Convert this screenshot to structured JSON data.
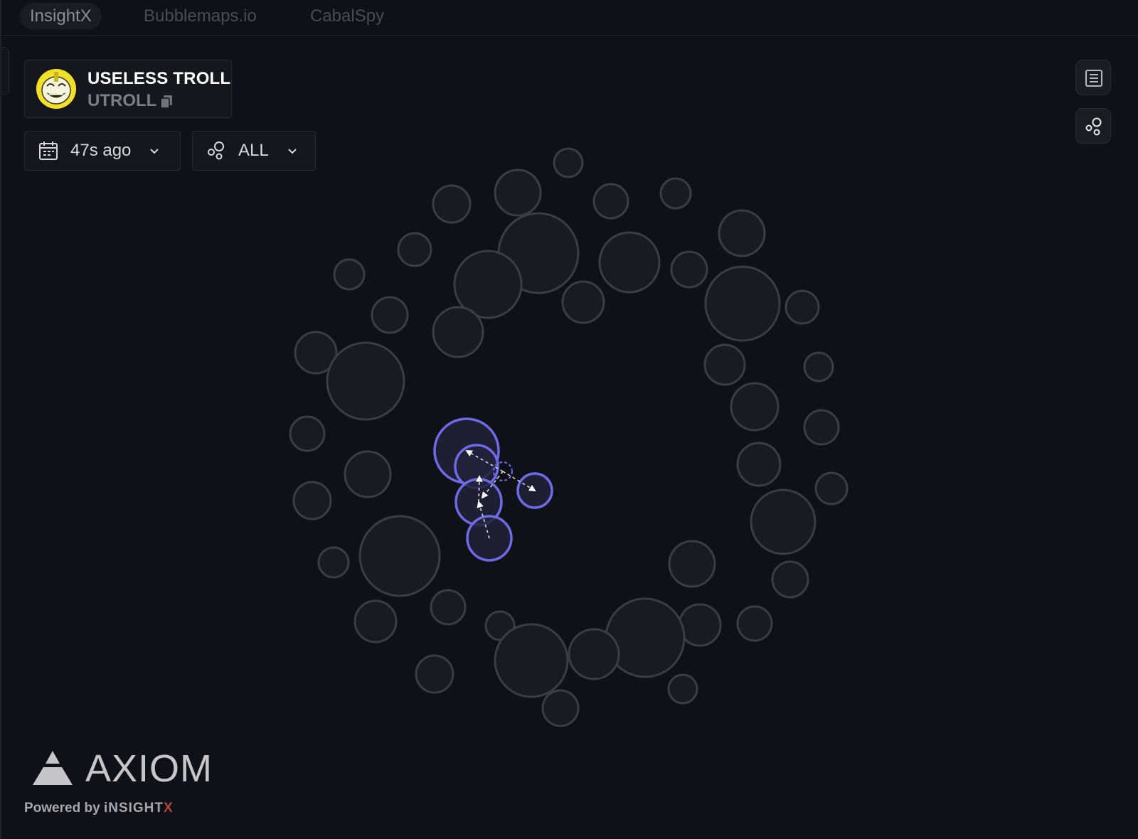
{
  "tabs": [
    {
      "label": "InsightX",
      "active": true
    },
    {
      "label": "Bubblemaps.io",
      "active": false
    },
    {
      "label": "CabalSpy",
      "active": false
    }
  ],
  "token": {
    "name": "USELESS TROLL",
    "symbol": "UTROLL",
    "avatar_icon": "troll-face-icon",
    "avatar_color": "#f1e02a"
  },
  "filters": {
    "time": {
      "label": "47s ago",
      "icon": "calendar-icon"
    },
    "cluster": {
      "label": "ALL",
      "icon": "bubbles-icon"
    }
  },
  "toolbar": {
    "list_icon": "list-icon",
    "bubbles_icon": "bubbles-icon"
  },
  "colors": {
    "background": "#101116",
    "bubble_stroke": "#3b3c45",
    "bubble_fill": "#1a1b22",
    "cluster_stroke": "#6f6be8",
    "cluster_fill": "#22223a"
  },
  "brand": {
    "name": "AXIOM",
    "powered_prefix": "Powered by",
    "powered_name": "iNSIGHT",
    "powered_x": "X"
  }
}
